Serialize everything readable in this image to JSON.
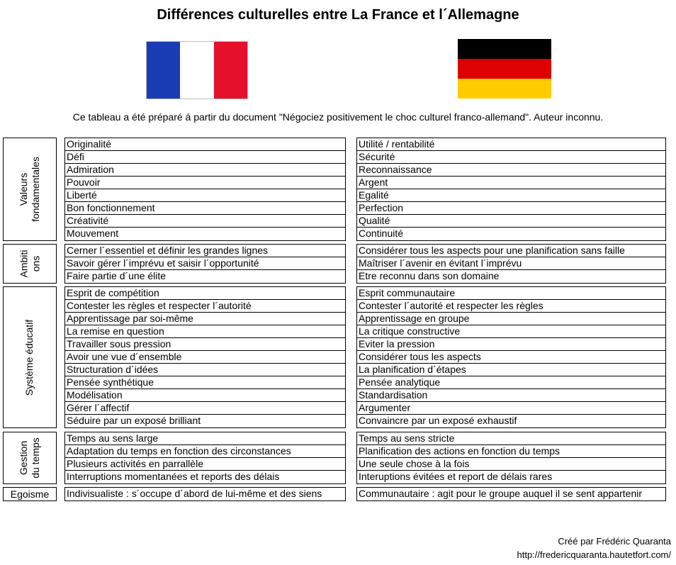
{
  "title": "Différences culturelles entre La France et l´Allemagne",
  "flags": {
    "france": {
      "icon": "france-flag-icon",
      "colors": [
        "#1A3DB5",
        "#FFFFFF",
        "#E5102A"
      ]
    },
    "germany": {
      "icon": "germany-flag-icon",
      "colors": [
        "#000000",
        "#DD0000",
        "#FFCC00"
      ]
    }
  },
  "subtitle": "Ce tableau a été préparé á partir du document \"Négociez positivement le choc culturel franco-allemand\". Auteur inconnu.",
  "sections": [
    {
      "label": "Valeurs fondamentales",
      "label_lines": [
        "Valeurs",
        "fondamentales"
      ],
      "france": [
        "Originalité",
        "Défi",
        "Admiration",
        "Pouvoir",
        "Liberté",
        "Bon fonctionnement",
        "Créativité",
        "Mouvement"
      ],
      "germany": [
        "Utilité / rentabilité",
        "Sécurité",
        "Reconnaissance",
        "Argent",
        "Egalité",
        "Perfection",
        "Qualité",
        "Continuité"
      ]
    },
    {
      "label": "Ambitions",
      "label_lines": [
        "Ambiti",
        "ons"
      ],
      "france": [
        "Cerner l´essentiel et définir les grandes lignes",
        "Savoir gérer l´imprévu et saisir l´opportunité",
        "Faire partie d´une élite"
      ],
      "germany": [
        "Considérer tous les aspects pour une planification sans faille",
        "Maîtriser l´avenir en évitant l´imprévu",
        "Etre reconnu dans son domaine"
      ]
    },
    {
      "label": "Système éducatif",
      "label_lines": [
        "Système éducatif"
      ],
      "france": [
        "Esprit de compétition",
        "Contester les règles et respecter l´autorité",
        "Apprentissage par soi-même",
        "La remise en question",
        "Travailler sous pression",
        "Avoir une vue d´ensemble",
        "Structuration d´idées",
        "Pensée synthétique",
        "Modélisation",
        "Gérer l´affectif",
        "Séduire par un exposé brilliant"
      ],
      "germany": [
        "Esprit communautaire",
        "Contester l´autorité et respecter les règles",
        "Apprentissage en groupe",
        "La critique constructive",
        "Eviter la pression",
        "Considérer tous les aspects",
        "La planification d´étapes",
        "Pensée analytique",
        "Standardisation",
        "Argumenter",
        "Convaincre par un exposé exhaustif"
      ]
    },
    {
      "label": "Gestion du temps",
      "label_lines": [
        "Gestion",
        "du temps"
      ],
      "france": [
        "Temps au sens large",
        "Adaptation du temps en fonction des circonstances",
        "Plusieurs activités en parrallèle",
        "Interruptions momentanées et reports des délais"
      ],
      "germany": [
        "Temps au sens stricte",
        "Planification des actions en fonction du temps",
        "Une seule chose à la fois",
        "Interuptions évitées et report de délais rares"
      ]
    },
    {
      "label": "Egoisme",
      "label_lines": [
        "Egoisme"
      ],
      "france": [
        "Indivisualiste : s´occupe d´abord de lui-même et des siens"
      ],
      "germany": [
        "Communautaire : agit pour le groupe auquel il se sent appartenir"
      ]
    }
  ],
  "credit": {
    "author": "Créé par Frédéric Quaranta",
    "url": "http://fredericquaranta.hautetfort.com/"
  }
}
